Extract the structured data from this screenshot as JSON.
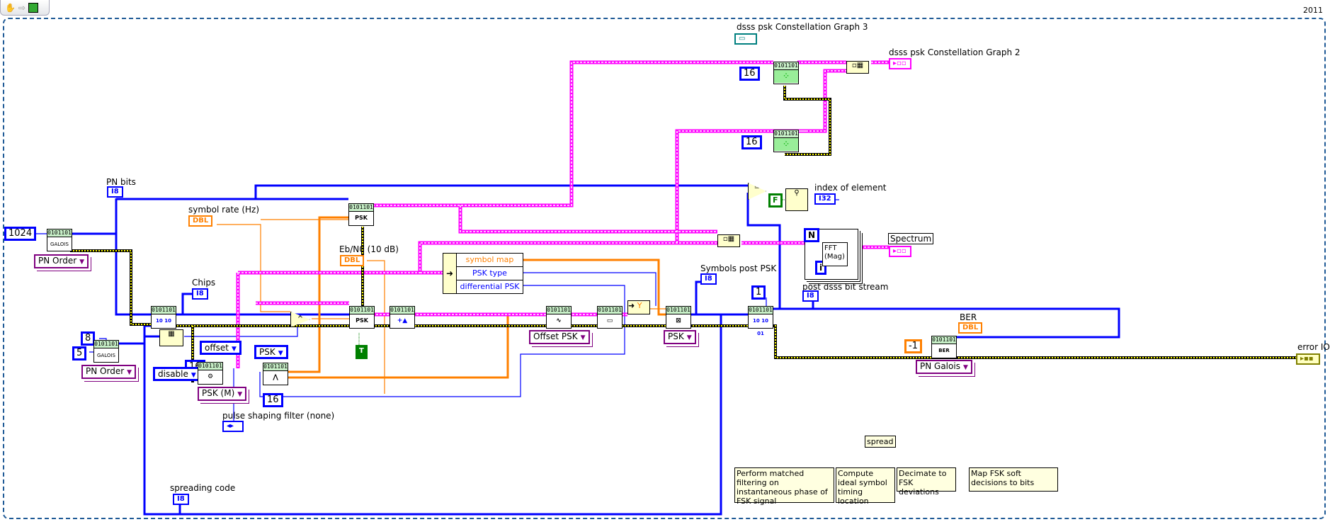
{
  "toolbar": {
    "icons": [
      "hand-tool-icon",
      "arrow-right-icon",
      "vi-icon"
    ]
  },
  "year": "2011",
  "vi_header": "0101101",
  "labels": {
    "pn_bits": "PN bits",
    "symbol_rate": "symbol rate (Hz)",
    "eb_n0": "Eb/N0 (10 dB)",
    "chips": "Chips",
    "pulse_shaping": "pulse shaping filter (none)",
    "spreading_code": "spreading code",
    "symbols_post_psk": "Symbols post PSK",
    "post_dsss": "post dsss bit stream",
    "index_of_element": "index of element",
    "spectrum": "Spectrum",
    "const_graph_3": "dsss psk Constellation Graph 3",
    "const_graph_2": "dsss psk Constellation Graph 2",
    "ber": "BER",
    "error_io": "error IO"
  },
  "terminals": {
    "i8": "I8",
    "i32": "I32",
    "dbl": "DBL"
  },
  "constants": {
    "c1024": "1024",
    "c8": "8",
    "c5": "5",
    "c16a": "16",
    "c16b": "16",
    "c16c": "16",
    "c16d": "16",
    "c1": "1",
    "cm1": "-1",
    "true": "T",
    "false": "F",
    "loop_n": "N",
    "loop_i": "i"
  },
  "rings": {
    "pn_order_1": "PN Order",
    "pn_order_2": "PN Order",
    "offset": "offset",
    "psk": "PSK",
    "disable": "disable",
    "psk_m": "PSK (M)",
    "offset_psk": "Offset PSK",
    "psk_2": "PSK",
    "pn_galois": "PN Galois"
  },
  "unbundle": {
    "items": [
      "symbol map",
      "PSK type",
      "differential PSK"
    ],
    "colors": [
      "#ff8000",
      "#0000ff",
      "#0000ff"
    ]
  },
  "unbundle_y": "Y",
  "fft": "FFT (Mag)",
  "glyphs": {
    "galois": "GALOIS",
    "psk": "PSK",
    "bits": "10 10 01",
    "ber": "BER"
  },
  "comments": {
    "spread": "spread",
    "matched": "Perform matched filtering on instantaneous phase of FSK signal",
    "timing": "Compute ideal symbol timing location",
    "decimate": "Decimate to FSK deviations",
    "map": "Map FSK soft decisions to bits"
  },
  "colors": {
    "integer": "#0000ff",
    "double": "#ff8000",
    "waveform": "#ff00ff",
    "error": "#ffff00",
    "boolean": "#008000",
    "frame": "#1f5a96"
  }
}
